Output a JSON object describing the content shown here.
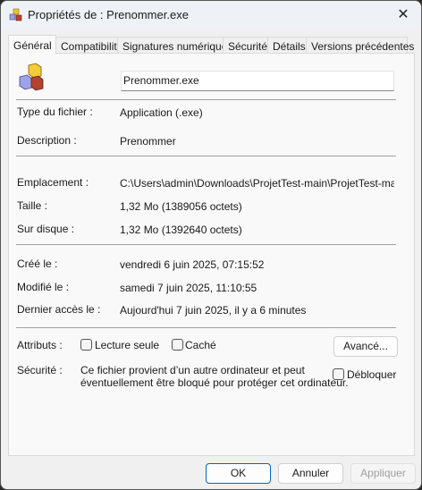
{
  "window": {
    "title": "Propriétés de : Prenommer.exe",
    "close_icon": "close-icon",
    "app_icon": "blocks-icon"
  },
  "tabs": [
    "Général",
    "Compatibilité",
    "Signatures numériques",
    "Sécurité",
    "Détails",
    "Versions précédentes"
  ],
  "file_name": "Prenommer.exe",
  "rows": {
    "type": {
      "label": "Type du fichier :",
      "value": "Application (.exe)"
    },
    "description": {
      "label": "Description :",
      "value": "Prenommer"
    },
    "location": {
      "label": "Emplacement :",
      "value": "C:\\Users\\admin\\Downloads\\ProjetTest-main\\ProjetTest-main\\Prenommer"
    },
    "size": {
      "label": "Taille :",
      "value": "1,32 Mo (1389056 octets)"
    },
    "disk": {
      "label": "Sur disque :",
      "value": "1,32 Mo (1392640 octets)"
    },
    "created": {
      "label": "Créé le :",
      "value": "vendredi 6 juin 2025, 07:15:52"
    },
    "modified": {
      "label": "Modifié le :",
      "value": "samedi 7 juin 2025, 11:10:55"
    },
    "accessed": {
      "label": "Dernier accès le :",
      "value": "Aujourd'hui 7 juin 2025, il y a 6 minutes"
    }
  },
  "attributes": {
    "label": "Attributs :",
    "readonly": "Lecture seule",
    "hidden": "Caché",
    "advanced": "Avancé..."
  },
  "security": {
    "label": "Sécurité :",
    "line1": "Ce fichier provient d’un autre ordinateur et peut",
    "line2": "éventuellement être bloqué pour protéger cet ordinateur.",
    "unblock": "Débloquer"
  },
  "buttons": {
    "ok": "OK",
    "cancel": "Annuler",
    "apply": "Appliquer"
  }
}
